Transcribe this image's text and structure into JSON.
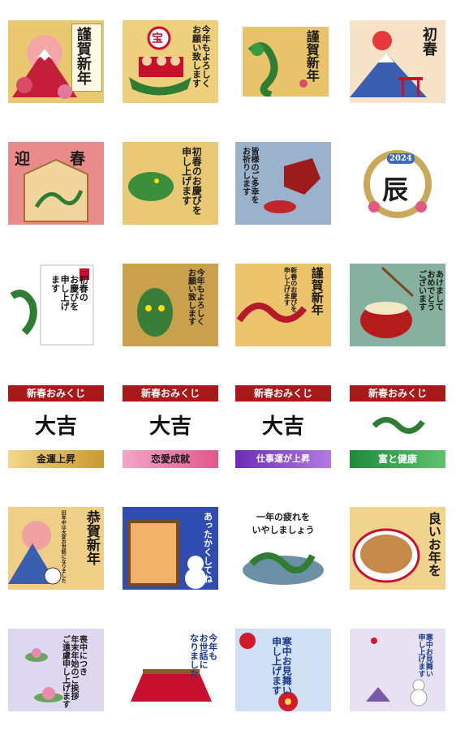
{
  "stickers": [
    {
      "text": "謹賀新年"
    },
    {
      "text": "今年もよろしく\nお願い致します",
      "badge": "宝"
    },
    {
      "text": "謹賀新年"
    },
    {
      "text": "初春"
    },
    {
      "text_left": "迎",
      "text_right": "春"
    },
    {
      "text": "初春のお慶びを\n申し上げます"
    },
    {
      "text": "皆様のご多幸を\nお祈りします"
    },
    {
      "year": "2024",
      "text": "辰"
    },
    {
      "text": "初春の\nお慶びを\n申し上げ\nます"
    },
    {
      "text": "今年もよろしく\nお願い致します"
    },
    {
      "text": "謹賀新年",
      "sub": "新春のお慶びを\n申し上げます"
    },
    {
      "text": "あけまして\nおめでとう\nございます"
    },
    {
      "header": "新春おみくじ",
      "fortune": "大吉",
      "footer": "金運上昇"
    },
    {
      "header": "新春おみくじ",
      "fortune": "大吉",
      "footer": "恋愛成就"
    },
    {
      "header": "新春おみくじ",
      "fortune": "大吉",
      "footer": "仕事運が上昇"
    },
    {
      "header": "新春おみくじ",
      "footer": "富と健康"
    },
    {
      "text": "恭賀新年",
      "sub": "旧年中は大変お世話になりました"
    },
    {
      "text": "あったかくしてね"
    },
    {
      "text": "一年の疲れを\nいやしましょう"
    },
    {
      "text": "良いお年を"
    },
    {
      "text": "喪中につき\n年末年始のご挨拶\nご遠慮申し上げます"
    },
    {
      "text": "今年も\nお世話に\nなりました"
    },
    {
      "text": "寒中お見舞い\n申し上げます"
    },
    {
      "text": "寒中お見舞い\n申し上げます"
    }
  ],
  "colors": {
    "gold": "#d9b24a",
    "red": "#c8102e",
    "green": "#2e7d32"
  }
}
